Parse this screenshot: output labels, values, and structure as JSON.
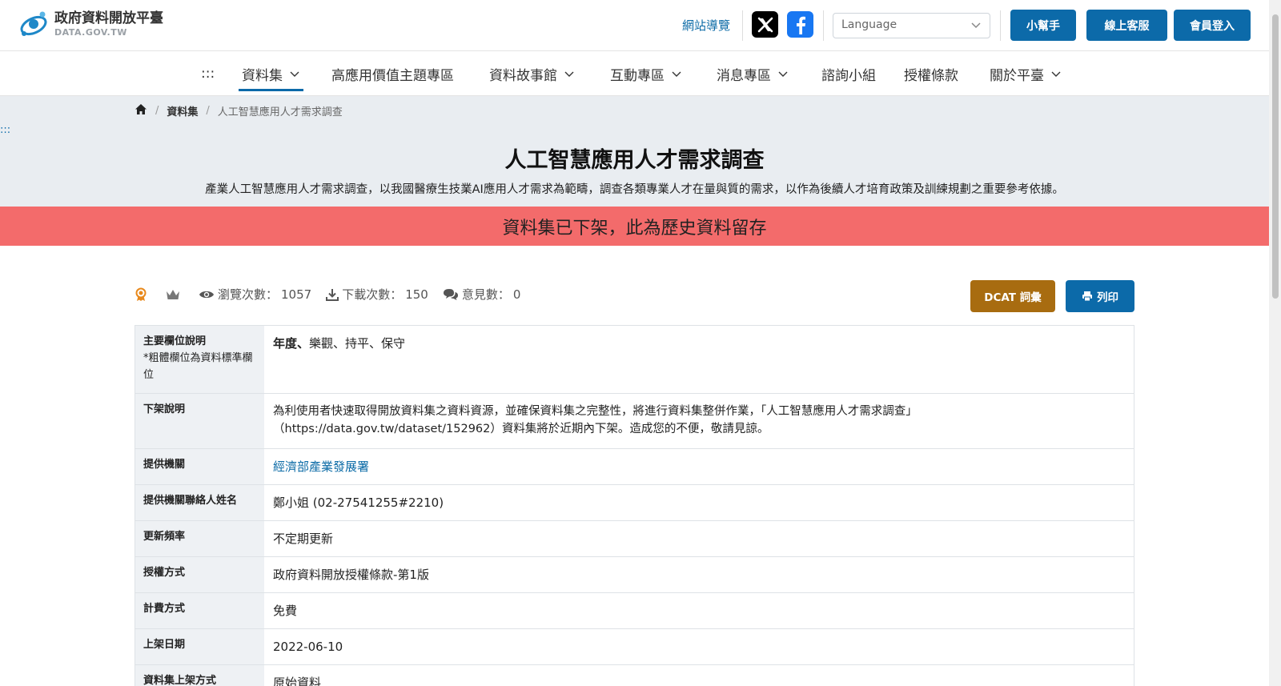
{
  "header": {
    "logo_title": "政府資料開放平臺",
    "logo_sub": "DATA.GOV.TW",
    "sitemap_label": "網站導覽",
    "language_placeholder": "Language",
    "helper_label": "小幫手",
    "support_label": "線上客服",
    "login_label": "會員登入",
    "brand_color": "#0c6aa9"
  },
  "nav": {
    "skip": ":::",
    "items": [
      {
        "label": "資料集",
        "dropdown": true,
        "active": true
      },
      {
        "label": "高應用價值主題專區",
        "dropdown": false
      },
      {
        "label": "資料故事館",
        "dropdown": true
      },
      {
        "label": "互動專區",
        "dropdown": true
      },
      {
        "label": "消息專區",
        "dropdown": true
      },
      {
        "label": "諮詢小組",
        "dropdown": false
      },
      {
        "label": "授權條款",
        "dropdown": false
      },
      {
        "label": "關於平臺",
        "dropdown": true
      }
    ]
  },
  "breadcrumb": {
    "level1": "資料集",
    "current": "人工智慧應用人才需求調查"
  },
  "skip_mark": ":::",
  "dataset": {
    "title": "人工智慧應用人才需求調查",
    "description": "產業人工智慧應用人才需求調查，以我國醫療生技業AI應用人才需求為範疇，調查各類專業人才在量與質的需求，以作為後續人才培育政策及訓練規劃之重要參考依據。",
    "banner": "資料集已下架，此為歷史資料留存",
    "banner_color": "#f36b6b"
  },
  "stats": {
    "views_label": "瀏覽次數：",
    "views": "1057",
    "downloads_label": "下載次數：",
    "downloads": "150",
    "comments_label": "意見數：",
    "comments": "0"
  },
  "actions": {
    "dcat_label": "DCAT 詞彙",
    "print_label": "列印"
  },
  "table": {
    "fields_label": "主要欄位說明",
    "fields_note": "*粗體欄位為資料標準欄位",
    "fields_bold": "年度、",
    "fields_rest": "樂觀、持平、保守",
    "delist_label": "下架說明",
    "delist_value": "為利使用者快速取得開放資料集之資料資源，並確保資料集之完整性，將進行資料集整併作業，「人工智慧應用人才需求調查」（https://data.gov.tw/dataset/152962）資料集將於近期內下架。造成您的不便，敬請見諒。",
    "agency_label": "提供機關",
    "agency_value": "經濟部產業發展署",
    "contact_label": "提供機關聯絡人姓名",
    "contact_value": "鄭小姐 (02-27541255#2210)",
    "frequency_label": "更新頻率",
    "frequency_value": "不定期更新",
    "license_label": "授權方式",
    "license_value": "政府資料開放授權條款-第1版",
    "fee_label": "計費方式",
    "fee_value": "免費",
    "published_label": "上架日期",
    "published_value": "2022-06-10",
    "method_label": "資料集上架方式",
    "method_value": "原始資料"
  }
}
